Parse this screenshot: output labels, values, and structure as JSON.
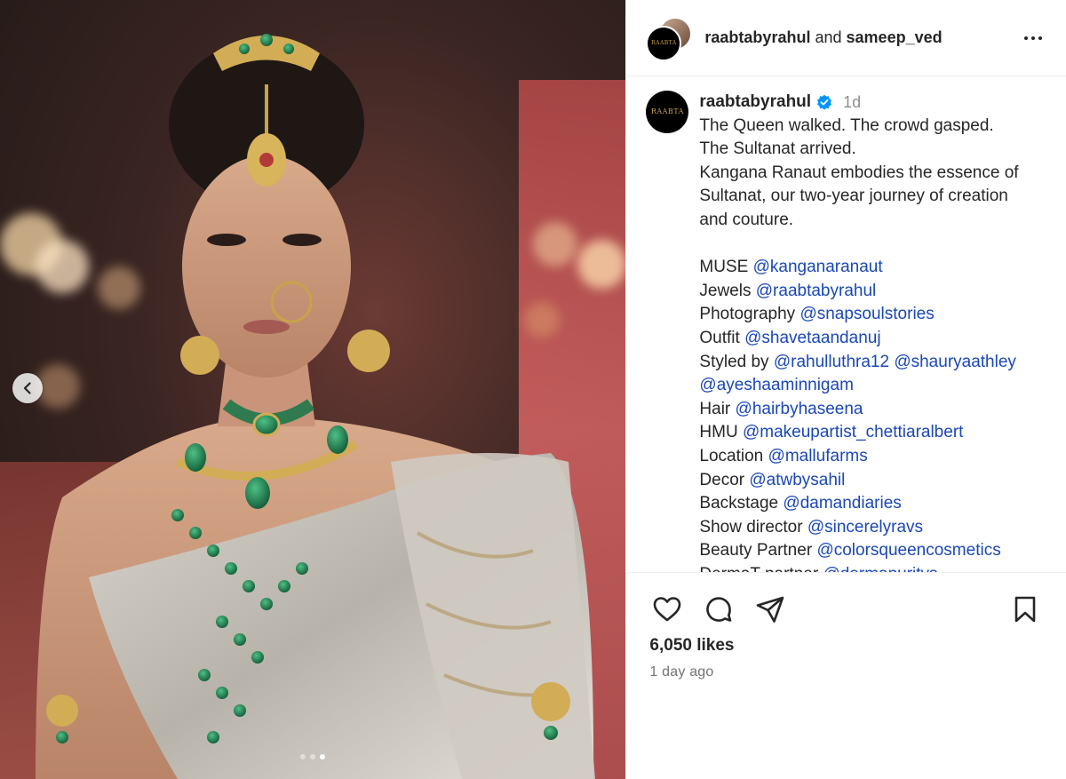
{
  "header": {
    "user_primary": "raabtabyrahul",
    "joiner": "and",
    "user_secondary": "sameep_ved",
    "logo_text": "RAABTA"
  },
  "caption": {
    "username": "raabtabyrahul",
    "time_short": "1d",
    "lines": [
      {
        "text": "The Queen walked. The crowd gasped."
      },
      {
        "text": "The Sultanat arrived."
      },
      {
        "text": "Kangana Ranaut embodies the essence of"
      },
      {
        "text": "Sultanat, our two-year journey of creation"
      },
      {
        "text": "and couture."
      }
    ],
    "credits": [
      {
        "label": "MUSE",
        "mentions": [
          "@kanganaranaut"
        ]
      },
      {
        "label": "Jewels",
        "mentions": [
          "@raabtabyrahul"
        ]
      },
      {
        "label": "Photography",
        "mentions": [
          "@snapsoulstories"
        ]
      },
      {
        "label": "Outfit",
        "mentions": [
          "@shavetaandanuj"
        ]
      },
      {
        "label": "Styled by",
        "mentions": [
          "@rahulluthra12",
          "@shauryaathley"
        ]
      },
      {
        "label": "",
        "mentions": [
          "@ayeshaaminnigam"
        ]
      },
      {
        "label": "Hair",
        "mentions": [
          "@hairbyhaseena"
        ]
      },
      {
        "label": "HMU",
        "mentions": [
          "@makeupartist_chettiaralbert"
        ]
      },
      {
        "label": "Location",
        "mentions": [
          "@mallufarms"
        ]
      },
      {
        "label": "Decor",
        "mentions": [
          "@atwbysahil"
        ]
      },
      {
        "label": "Backstage",
        "mentions": [
          "@damandiaries"
        ]
      },
      {
        "label": "Show director",
        "mentions": [
          "@sincerelyravs"
        ]
      },
      {
        "label": "Beauty Partner",
        "mentions": [
          "@colorsqueencosmetics"
        ]
      },
      {
        "label": "DermaT partner",
        "mentions": [
          "@dermapuritys"
        ]
      }
    ]
  },
  "actions": {
    "like_icon": "heart-icon",
    "comment_icon": "comment-icon",
    "share_icon": "paper-plane-icon",
    "save_icon": "bookmark-icon"
  },
  "stats": {
    "likes": "6,050 likes",
    "posted": "1 day ago"
  },
  "carousel": {
    "slide_count": 3,
    "active_index": 2
  },
  "colors": {
    "accent_link": "#1a47b8",
    "verified_blue": "#0095f6",
    "muted": "#737373"
  }
}
